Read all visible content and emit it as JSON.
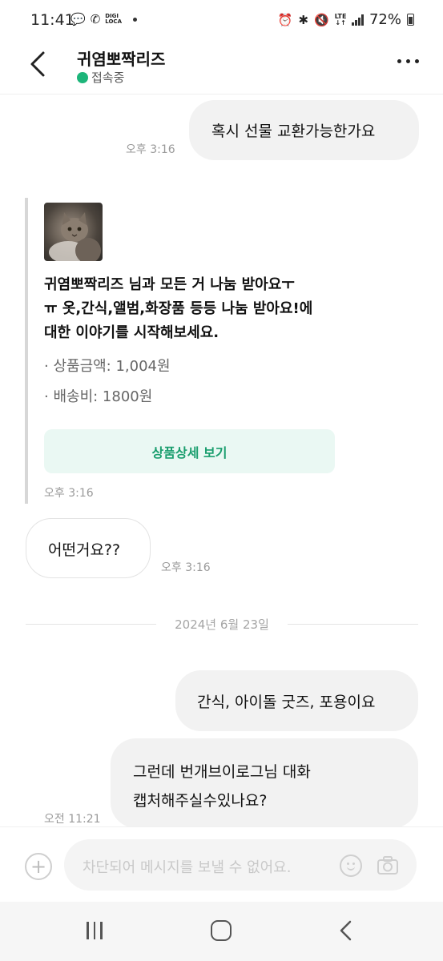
{
  "status_bar": {
    "time": "11:41",
    "digi_line1": "DIGI",
    "digi_line2": "LOCA",
    "lte_top": "LTE",
    "lte_bottom": "↓↑",
    "battery": "72%"
  },
  "header": {
    "title": "귀염뽀짝리즈",
    "status": "접속중"
  },
  "messages": [
    {
      "text": "혹시 선물 교환가능한가요",
      "time": "오후 3:16"
    },
    {
      "text": "어떤거요??",
      "time": "오후 3:16"
    },
    {
      "text": "간식, 아이돌 굿즈, 포용이요"
    },
    {
      "line1": "그런데 번개브이로그님 대화",
      "line2": "캡처해주실수있나요?",
      "time": "오전 11:21"
    }
  ],
  "product_card": {
    "line1": "귀염뽀짝리즈 님과 모든 거 나눔 받아요ㅜ",
    "line2": "ㅠ 옷,간식,앨범,화장품 등등 나눔 받아요!에",
    "line3": "대한 이야기를 시작해보세요.",
    "price": "· 상품금액: 1,004원",
    "shipping": "· 배송비: 1800원",
    "button": "상품상세 보기",
    "time": "오후 3:16"
  },
  "date_divider": "2024년 6월 23일",
  "input": {
    "placeholder": "차단되어 메시지를 보낼 수 없어요."
  },
  "colors": {
    "online": "#1db57a",
    "card_button_bg": "#eaf8f3",
    "card_button_text": "#1a9e6e",
    "bubble_out": "#f2f2f2"
  }
}
